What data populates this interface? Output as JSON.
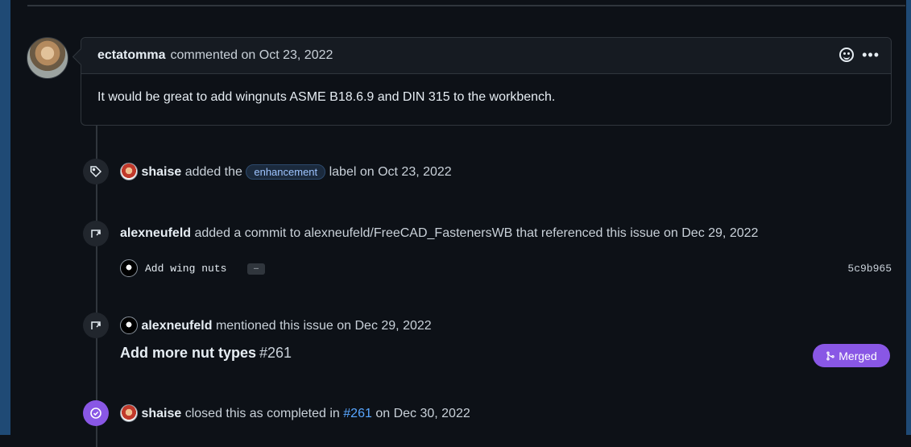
{
  "comment": {
    "author": "ectatomma",
    "meta": "commented on Oct 23, 2022",
    "body": "It would be great to add wingnuts ASME B18.6.9 and DIN 315 to the workbench."
  },
  "events": {
    "label_event": {
      "actor": "shaise",
      "text_before": "added the",
      "label": "enhancement",
      "text_after": "label on Oct 23, 2022"
    },
    "commit_event": {
      "actor": "alexneufeld",
      "text": "added a commit to alexneufeld/FreeCAD_FastenersWB that referenced this issue on Dec 29, 2022",
      "commit_message": "Add wing nuts",
      "commit_ellipsis": "…",
      "commit_sha": "5c9b965"
    },
    "mention_event": {
      "actor": "alexneufeld",
      "text": "mentioned this issue on Dec 29, 2022",
      "pr_title": "Add more nut types",
      "pr_number": "#261",
      "pr_status": "Merged"
    },
    "close_event": {
      "actor": "shaise",
      "text_before": "closed this as completed in",
      "link": "#261",
      "text_after": "on Dec 30, 2022"
    }
  },
  "colors": {
    "background": "#0d1117",
    "accent_purple": "#8957e5",
    "link_blue": "#58a6ff",
    "label_blue": "#9ec4ff"
  },
  "icons": {
    "label_badge": "tag-icon",
    "commit_badge": "cross-reference-icon",
    "mention_badge": "cross-reference-icon",
    "close_badge": "check-circle-icon",
    "merged": "git-merge-icon",
    "reaction": "smiley-icon",
    "menu": "kebab-icon"
  }
}
